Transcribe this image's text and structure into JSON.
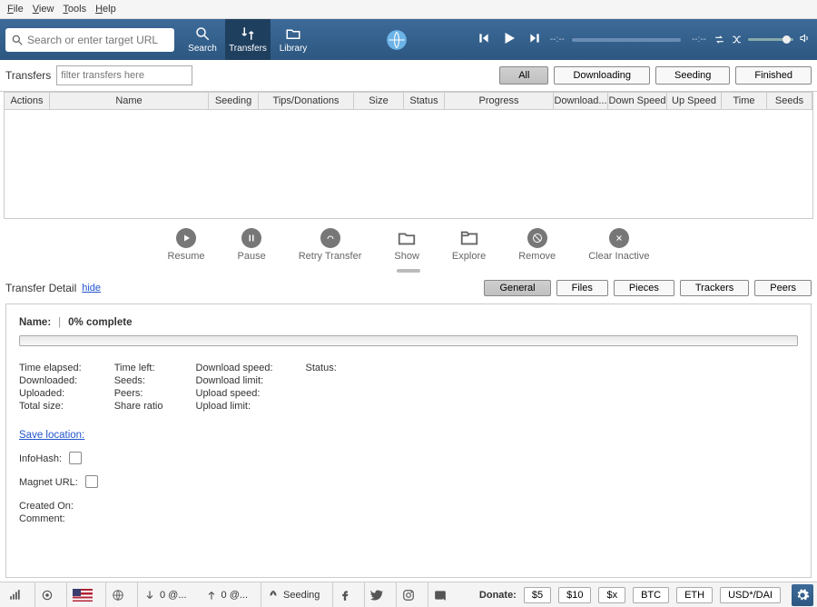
{
  "menu": {
    "file": "File",
    "view": "View",
    "tools": "Tools",
    "help": "Help"
  },
  "toolbar": {
    "search_placeholder": "Search or enter target URL",
    "search_label": "Search",
    "transfers_label": "Transfers",
    "library_label": "Library",
    "time_current": "--:--",
    "time_total": "--:--"
  },
  "filter": {
    "transfers_label": "Transfers",
    "filter_placeholder": "filter transfers here",
    "all": "All",
    "downloading": "Downloading",
    "seeding": "Seeding",
    "finished": "Finished"
  },
  "cols": {
    "actions": "Actions",
    "name": "Name",
    "seeding": "Seeding",
    "tips": "Tips/Donations",
    "size": "Size",
    "status": "Status",
    "progress": "Progress",
    "dlat": "Download...",
    "down": "Down Speed",
    "up": "Up Speed",
    "time": "Time",
    "seeds": "Seeds"
  },
  "actions": {
    "resume": "Resume",
    "pause": "Pause",
    "retry": "Retry Transfer",
    "show": "Show",
    "explore": "Explore",
    "remove": "Remove",
    "clear": "Clear Inactive"
  },
  "detail": {
    "title": "Transfer Detail",
    "hide": "hide",
    "general": "General",
    "files": "Files",
    "pieces": "Pieces",
    "trackers": "Trackers",
    "peers": "Peers"
  },
  "panel": {
    "name_label": "Name:",
    "div": "|",
    "complete": "0% complete",
    "time_elapsed": "Time elapsed:",
    "time_left": "Time left:",
    "dl_speed": "Download speed:",
    "status": "Status:",
    "downloaded": "Downloaded:",
    "seeds": "Seeds:",
    "dl_limit": "Download limit:",
    "uploaded": "Uploaded:",
    "peers": "Peers:",
    "ul_speed": "Upload speed:",
    "total_size": "Total size:",
    "share_ratio": "Share ratio",
    "ul_limit": "Upload limit:",
    "save_location": "Save location:",
    "infohash": "InfoHash:",
    "magnet": "Magnet URL:",
    "created": "Created On:",
    "comment": "Comment:"
  },
  "status": {
    "down_rate": "0 @...",
    "up_rate": "0 @...",
    "seeding": "Seeding",
    "donate": "Donate:",
    "d5": "$5",
    "d10": "$10",
    "dx": "$x",
    "btc": "BTC",
    "eth": "ETH",
    "usd": "USD*/DAI"
  }
}
